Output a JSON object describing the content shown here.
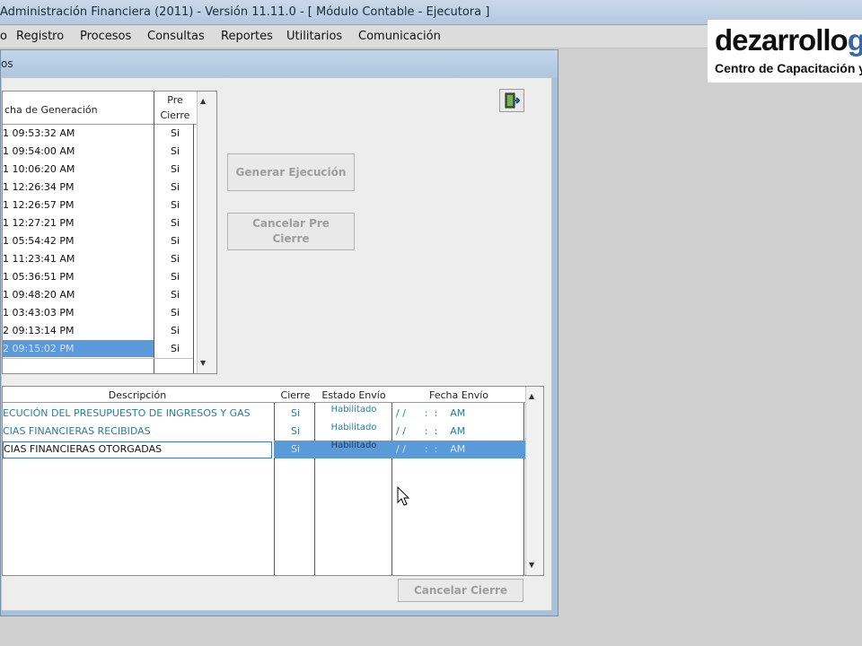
{
  "window": {
    "title": "Administración Financiera (2011) - Versión 11.11.0 - [ Módulo Contable - Ejecutora ]"
  },
  "menu": [
    "o",
    "Registro",
    "Procesos",
    "Consultas",
    "Reportes",
    "Utilitarios",
    "Comunicación"
  ],
  "logo": {
    "brand": "dezarrollo",
    "brand_accent": "gl",
    "tagline": "Centro de Capacitación y"
  },
  "dialog": {
    "title": "os"
  },
  "generation_grid": {
    "col_date": "cha de Generación",
    "col_pre_line1": "Pre",
    "col_pre_line2": "Cierre",
    "rows": [
      {
        "date": "1 09:53:32 AM",
        "pre": "Si"
      },
      {
        "date": "1 09:54:00 AM",
        "pre": "Si"
      },
      {
        "date": "1 10:06:20 AM",
        "pre": "Si"
      },
      {
        "date": "1 12:26:34 PM",
        "pre": "Si"
      },
      {
        "date": "1 12:26:57 PM",
        "pre": "Si"
      },
      {
        "date": "1 12:27:21 PM",
        "pre": "Si"
      },
      {
        "date": "1 05:54:42 PM",
        "pre": "Si"
      },
      {
        "date": "1 11:23:41 AM",
        "pre": "Si"
      },
      {
        "date": "1 05:36:51 PM",
        "pre": "Si"
      },
      {
        "date": "1 09:48:20 AM",
        "pre": "Si"
      },
      {
        "date": "1 03:43:03 PM",
        "pre": "Si"
      },
      {
        "date": "2 09:13:14 PM",
        "pre": "Si"
      },
      {
        "date": "2 09:15:02 PM",
        "pre": "Si"
      }
    ]
  },
  "buttons": {
    "generar": "Generar Ejecución",
    "cancelar_pre_1": "Cancelar Pre",
    "cancelar_pre_2": "Cierre",
    "cancelar_cierre": "Cancelar Cierre"
  },
  "report_grid": {
    "col_desc": "Descripción",
    "col_cierre": "Cierre",
    "col_estado": "Estado Envío",
    "col_fecha": "Fecha Envío",
    "rows": [
      {
        "desc": "ECUCIÓN DEL PRESUPUESTO DE INGRESOS Y GAS",
        "cierre": "Si",
        "estado": "Habilitado",
        "fecha": "/ /      :  :    AM"
      },
      {
        "desc": "CIAS FINANCIERAS RECIBIDAS",
        "cierre": "Si",
        "estado": "Habilitado",
        "fecha": "/ /      :  :    AM"
      },
      {
        "desc": "CIAS FINANCIERAS OTORGADAS",
        "cierre": "Si",
        "estado": "Habilitado",
        "fecha": "/ /      :  :    AM"
      }
    ]
  },
  "colors": {
    "selection": "#5b9ad8",
    "teal_text": "#2a7f95",
    "dialog_frame": "#a8c0d8"
  }
}
